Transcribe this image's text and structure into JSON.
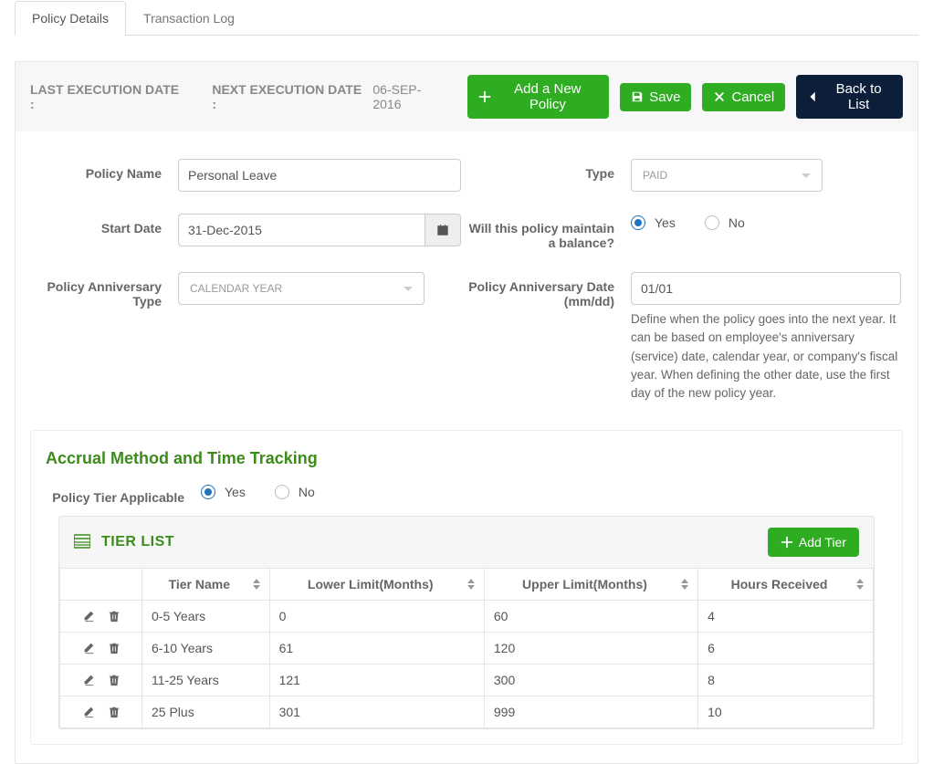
{
  "tabs": {
    "policy_details": "Policy Details",
    "transaction_log": "Transaction Log"
  },
  "header": {
    "last_exec_label": "LAST EXECUTION DATE :",
    "last_exec_value": "",
    "next_exec_label": "NEXT EXECUTION DATE :",
    "next_exec_value": "06-SEP-2016",
    "add_policy": "Add a New Policy",
    "save": "Save",
    "cancel": "Cancel",
    "back": "Back to List"
  },
  "form": {
    "policy_name_label": "Policy Name",
    "policy_name_value": "Personal Leave",
    "type_label": "Type",
    "type_value": "PAID",
    "start_date_label": "Start Date",
    "start_date_value": "31-Dec-2015",
    "balance_label": "Will this policy maintain a balance?",
    "yes": "Yes",
    "no": "No",
    "anniv_type_label": "Policy Anniversary Type",
    "anniv_type_value": "CALENDAR YEAR",
    "anniv_date_label": "Policy Anniversary Date (mm/dd)",
    "anniv_date_value": "01/01",
    "anniv_helper": "Define when the policy goes into the next year. It can be based on employee's anniversary (service) date, calendar year, or company's fiscal year. When defining the other date, use the first day of the new policy year."
  },
  "accrual": {
    "title": "Accrual Method and Time Tracking",
    "tier_applicable_label": "Policy Tier Applicable",
    "yes": "Yes",
    "no": "No"
  },
  "tier": {
    "title": "TIER LIST",
    "add_tier": "Add Tier",
    "columns": {
      "tier_name": "Tier Name",
      "lower": "Lower Limit(Months)",
      "upper": "Upper Limit(Months)",
      "hours": "Hours Received"
    },
    "rows": [
      {
        "name": "0-5 Years",
        "lower": "0",
        "upper": "60",
        "hours": "4"
      },
      {
        "name": "6-10 Years",
        "lower": "61",
        "upper": "120",
        "hours": "6"
      },
      {
        "name": "11-25 Years",
        "lower": "121",
        "upper": "300",
        "hours": "8"
      },
      {
        "name": "25 Plus",
        "lower": "301",
        "upper": "999",
        "hours": "10"
      }
    ]
  }
}
